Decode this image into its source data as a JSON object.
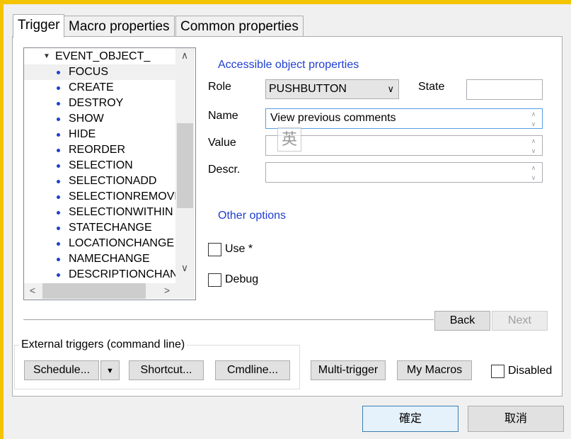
{
  "tabs": [
    {
      "label": "Trigger",
      "active": true
    },
    {
      "label": "Macro properties",
      "active": false
    },
    {
      "label": "Common properties",
      "active": false
    }
  ],
  "tree": {
    "root": "EVENT_OBJECT_",
    "items": [
      "FOCUS",
      "CREATE",
      "DESTROY",
      "SHOW",
      "HIDE",
      "REORDER",
      "SELECTION",
      "SELECTIONADD",
      "SELECTIONREMOVE",
      "SELECTIONWITHIN",
      "STATECHANGE",
      "LOCATIONCHANGE",
      "NAMECHANGE",
      "DESCRIPTIONCHANG"
    ],
    "selected": "FOCUS"
  },
  "accessible": {
    "title": "Accessible object properties",
    "role_label": "Role",
    "role_value": "PUSHBUTTON",
    "state_label": "State",
    "state_value": "",
    "name_label": "Name",
    "name_value": "View previous comments",
    "value_label": "Value",
    "value_value": "",
    "descr_label": "Descr.",
    "descr_value": ""
  },
  "ime_indicator": "英",
  "other_options": {
    "title": "Other options",
    "use_label": "Use *",
    "debug_label": "Debug"
  },
  "nav": {
    "back": "Back",
    "next": "Next"
  },
  "external": {
    "title": "External triggers (command line)",
    "schedule": "Schedule...",
    "shortcut": "Shortcut...",
    "cmdline": "Cmdline..."
  },
  "multi_trigger": "Multi-trigger",
  "my_macros": "My Macros",
  "disabled_label": "Disabled",
  "dialog": {
    "ok": "確定",
    "cancel": "取消"
  },
  "colors": {
    "accent_text": "#1f3fd0",
    "window_border": "#f4c400"
  }
}
